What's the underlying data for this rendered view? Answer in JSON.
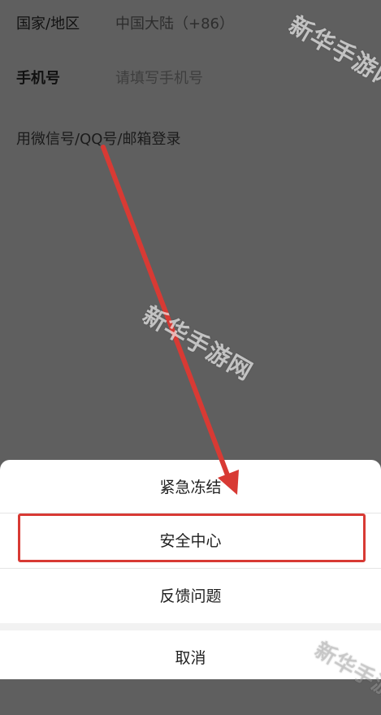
{
  "form": {
    "country_label": "国家/地区",
    "country_value": "中国大陆（+86）",
    "phone_label": "手机号",
    "phone_placeholder": "请填写手机号",
    "alt_login": "用微信号/QQ号/邮箱登录"
  },
  "action_sheet": {
    "items": [
      {
        "label": "紧急冻结"
      },
      {
        "label": "安全中心"
      },
      {
        "label": "反馈问题"
      }
    ],
    "cancel_label": "取消"
  },
  "watermarks": {
    "text": "新华手游网"
  },
  "colors": {
    "overlay": "#5f5f5f",
    "highlight": "#d83a34",
    "arrow": "#d83a34",
    "sheet_background": "#ffffff"
  }
}
